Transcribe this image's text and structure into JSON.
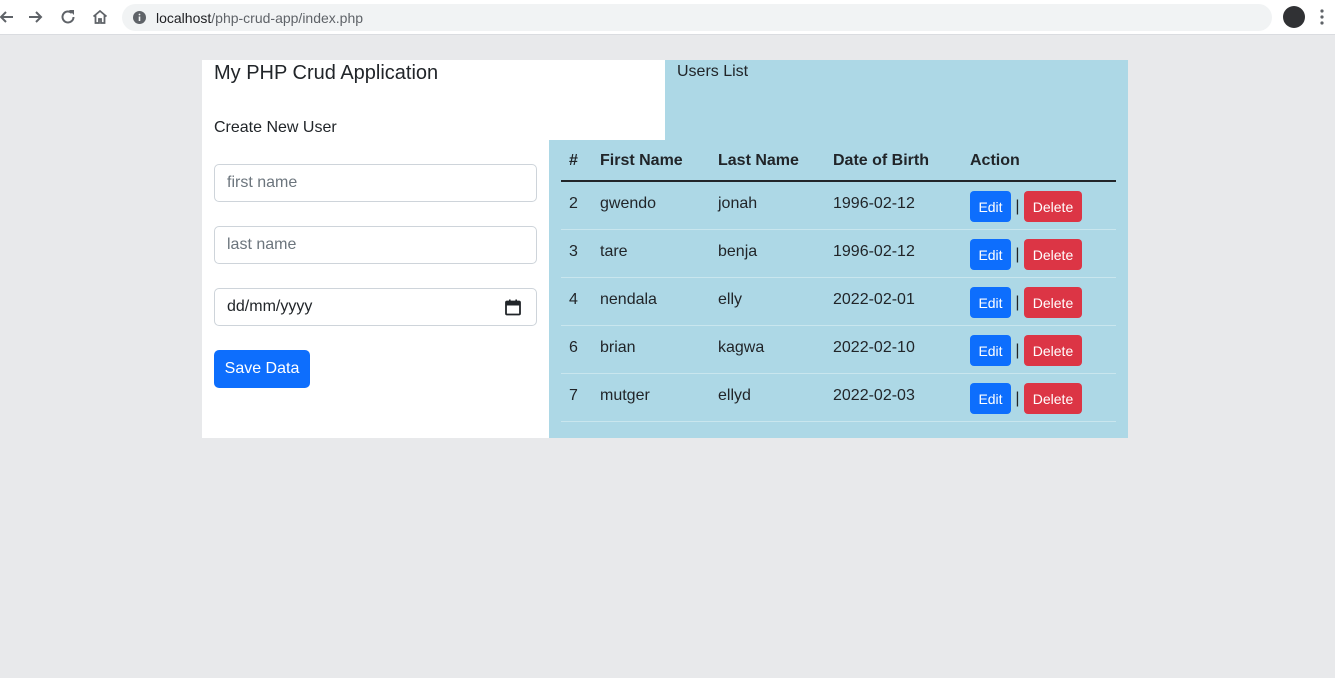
{
  "browser": {
    "url_host": "localhost",
    "url_path": "/php-crud-app/index.php"
  },
  "header": {
    "title": "My PHP Crud Application"
  },
  "users_list": {
    "title": "Users List"
  },
  "form": {
    "title": "Create New User",
    "first_name_placeholder": "first name",
    "last_name_placeholder": "last name",
    "dob_value": "dd/mm/yyyy",
    "save_label": "Save Data"
  },
  "table": {
    "headers": [
      "#",
      "First Name",
      "Last Name",
      "Date of Birth",
      "Action"
    ],
    "rows": [
      {
        "id": "2",
        "first": "gwendo",
        "last": "jonah",
        "dob": "1996-02-12"
      },
      {
        "id": "3",
        "first": "tare",
        "last": "benja",
        "dob": "1996-02-12"
      },
      {
        "id": "4",
        "first": "nendala",
        "last": "elly",
        "dob": "2022-02-01"
      },
      {
        "id": "6",
        "first": "brian",
        "last": "kagwa",
        "dob": "2022-02-10"
      },
      {
        "id": "7",
        "first": "mutger",
        "last": "ellyd",
        "dob": "2022-02-03"
      }
    ],
    "edit_label": "Edit",
    "separator": "|",
    "delete_label": "Delete"
  },
  "colors": {
    "primary": "#0d6efd",
    "danger": "#dc3545",
    "panel_blue": "#add8e6",
    "page_bg": "#e8e9eb"
  }
}
